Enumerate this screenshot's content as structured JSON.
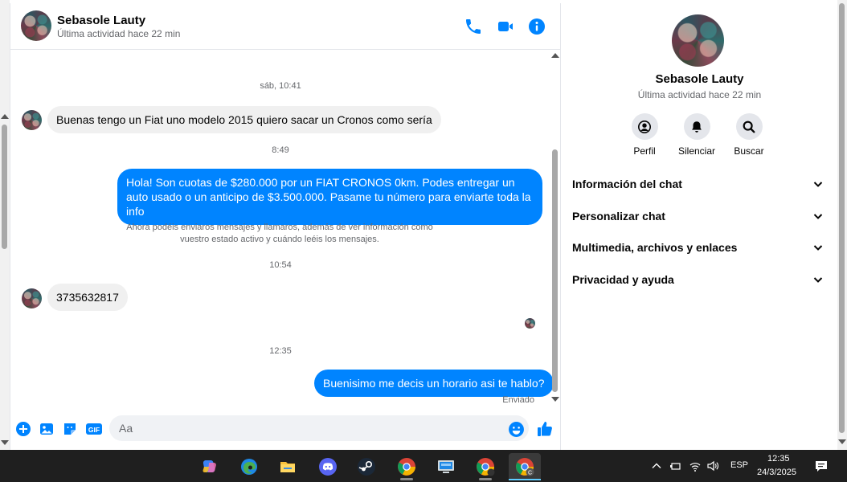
{
  "header": {
    "contact_name": "Sebasole Lauty",
    "status": "Última actividad hace 22 min",
    "icons": [
      "phone-icon",
      "video-camera-icon",
      "info-icon"
    ],
    "accent_color": "#0084ff"
  },
  "messages": {
    "timestamps": [
      "sáb, 10:41",
      "8:49",
      "10:54",
      "12:35"
    ],
    "incoming_1": "Buenas tengo un Fiat uno modelo 2015 quiero sacar un Cronos como sería",
    "outgoing_1": "Hola! Son cuotas de $280.000 por un FIAT CRONOS 0km. Podes entregar un auto usado o un anticipo de $3.500.000. Pasame tu número para enviarte toda la info",
    "notice": "Ahora podéis enviaros mensajes y llamaros, además de ver información como vuestro estado activo y cuándo leéis los mensajes.",
    "incoming_2": "3735632817",
    "outgoing_2": "Buenisimo me decis un horario asi te hablo?",
    "sent_status": "Enviado"
  },
  "composer": {
    "placeholder": "Aa",
    "value": "",
    "icons": [
      "plus-icon",
      "image-icon",
      "sticker-icon",
      "gif-icon",
      "emoji-icon",
      "like-icon"
    ],
    "gif_label": "GIF"
  },
  "info_panel": {
    "name": "Sebasole Lauty",
    "status": "Última actividad hace 22 min",
    "actions": [
      {
        "label": "Perfil",
        "icon": "profile-icon"
      },
      {
        "label": "Silenciar",
        "icon": "bell-icon"
      },
      {
        "label": "Buscar",
        "icon": "search-icon"
      }
    ],
    "sections": [
      "Información del chat",
      "Personalizar chat",
      "Multimedia, archivos y enlaces",
      "Privacidad y ayuda"
    ]
  },
  "taskbar": {
    "apps": [
      "copilot-icon",
      "edge-icon",
      "file-explorer-icon",
      "discord-icon",
      "steam-icon",
      "chrome-icon",
      "remote-desktop-icon",
      "chrome-icon",
      "chrome-icon"
    ],
    "language": "ESP",
    "time": "12:35",
    "date": "24/3/2025",
    "chrome_profile_letter": "C"
  }
}
